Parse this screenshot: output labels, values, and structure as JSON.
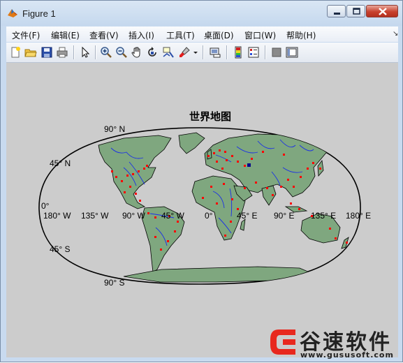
{
  "window": {
    "title": "Figure 1",
    "controls": {
      "minimize_icon": "minimize-icon",
      "maximize_icon": "maximize-icon",
      "close_icon": "close-icon"
    }
  },
  "menubar": {
    "items": [
      {
        "label": "文件(F)"
      },
      {
        "label": "编辑(E)"
      },
      {
        "label": "查看(V)"
      },
      {
        "label": "插入(I)"
      },
      {
        "label": "工具(T)"
      },
      {
        "label": "桌面(D)"
      },
      {
        "label": "窗口(W)"
      },
      {
        "label": "帮助(H)"
      }
    ],
    "overflow_icon": "menu-overflow-arrow"
  },
  "toolbar": {
    "buttons": [
      "new-figure-icon",
      "open-file-icon",
      "save-icon",
      "print-icon",
      "edit-plot-arrow-icon",
      "zoom-in-icon",
      "zoom-out-icon",
      "pan-hand-icon",
      "rotate-3d-icon",
      "data-cursor-icon",
      "brush-icon",
      "brush-dropdown-icon",
      "link-plot-icon",
      "insert-colorbar-icon",
      "insert-legend-icon",
      "hide-plot-tools-icon",
      "show-plot-tools-icon"
    ]
  },
  "plot": {
    "title": "世界地图",
    "lat_labels": [
      "90° N",
      "45° N",
      "0°",
      "45° S",
      "90° S"
    ],
    "lon_labels": [
      "180° W",
      "135° W",
      "90° W",
      "45° W",
      "0°",
      "45° E",
      "90° E",
      "135° E",
      "180° E"
    ],
    "colors": {
      "figure_background": "#cccccc",
      "land": "#7fa77f",
      "rivers": "#1a2ee8",
      "cities": "#ff0000",
      "coastline": "#000000"
    }
  },
  "watermark": {
    "brand": "谷速软件",
    "url": "www.gususoft.com",
    "logo_color": "#e8281e"
  }
}
